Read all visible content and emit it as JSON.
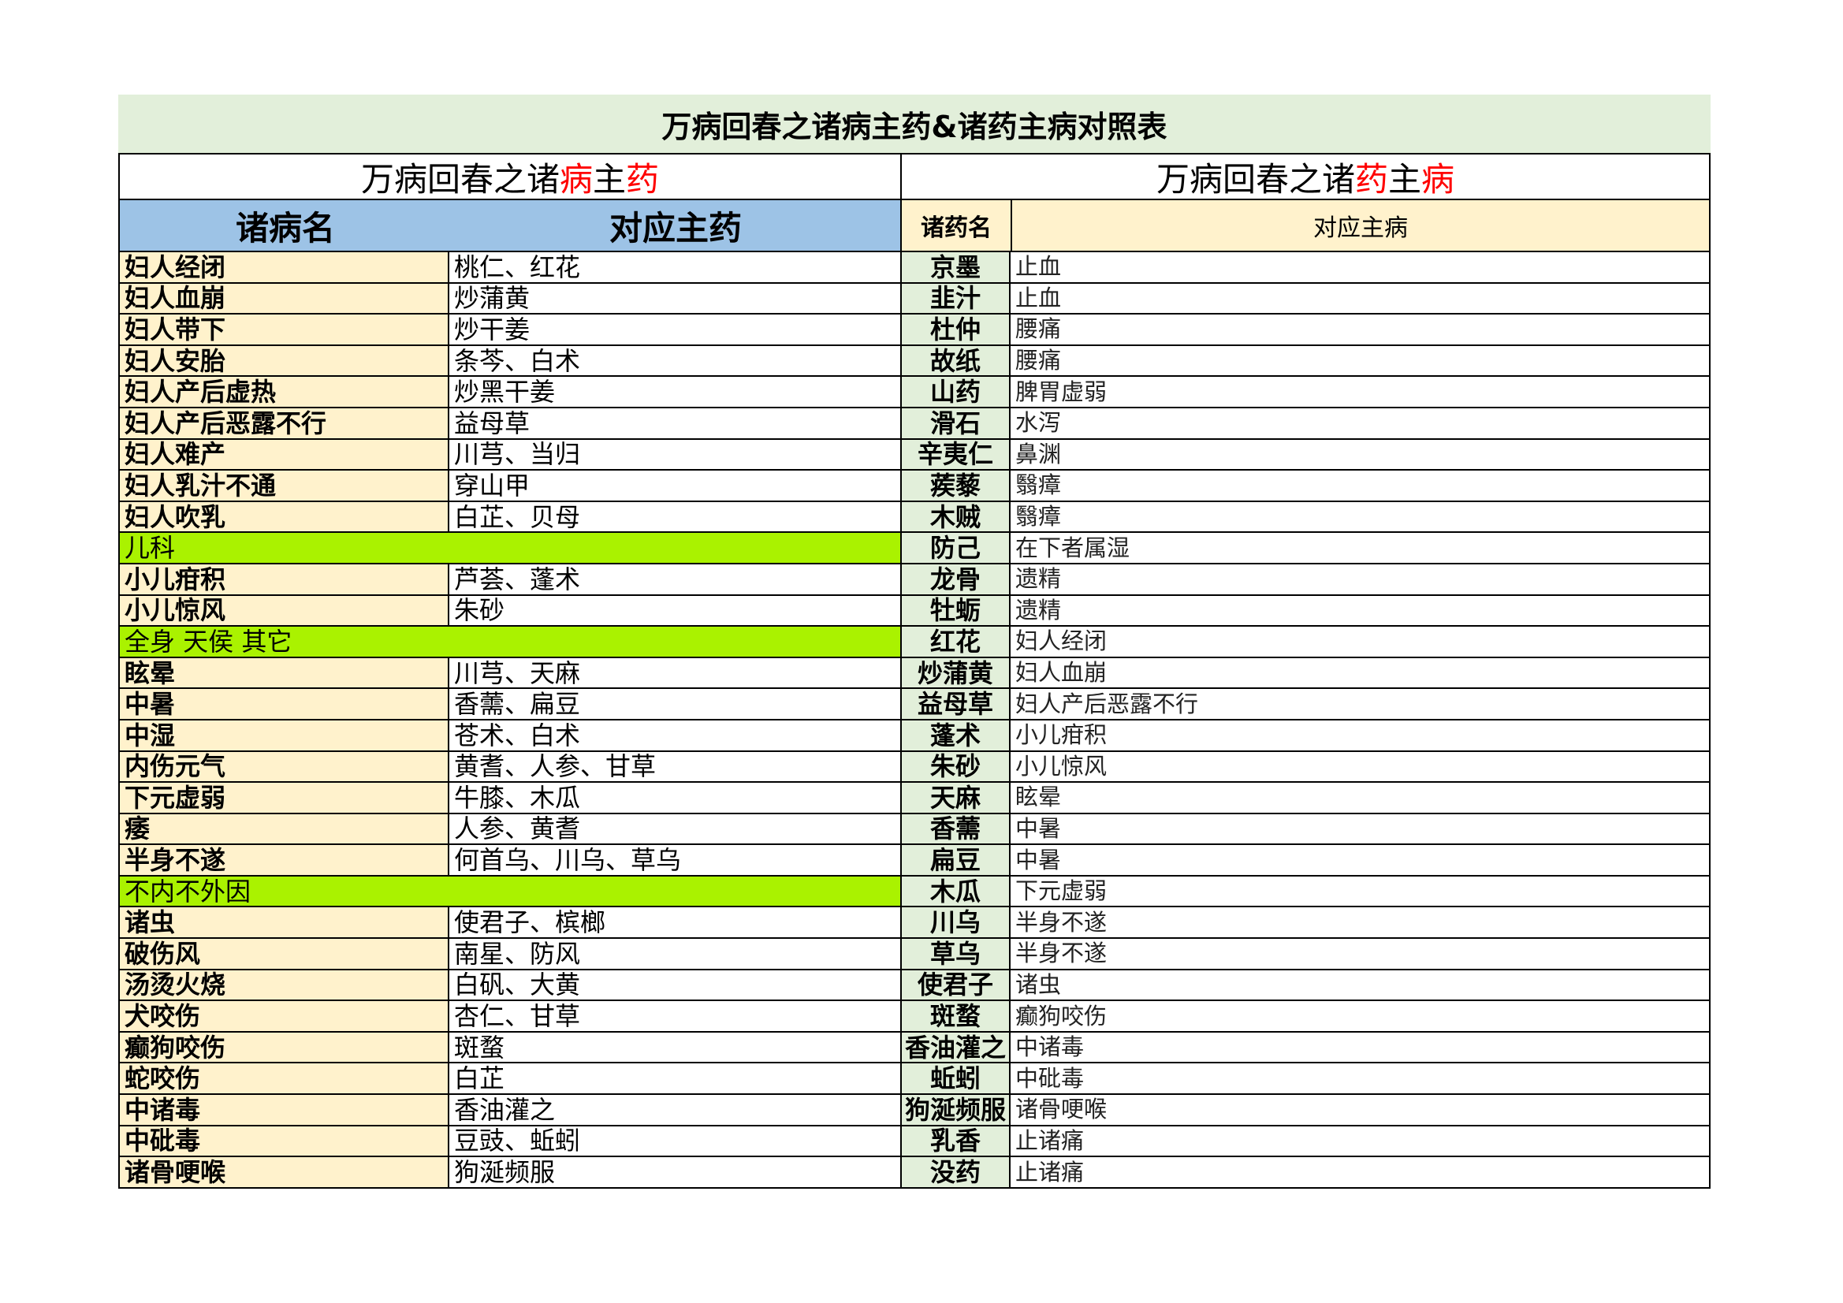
{
  "title": "万病回春之诸病主药&诸药主病对照表",
  "left_heading": {
    "pre": "万病回春之诸",
    "mid": "病",
    "mid2": "主",
    "post": "药"
  },
  "right_heading": {
    "pre": "万病回春之诸",
    "mid": "药",
    "mid2": "主",
    "post": "病"
  },
  "left_columns": {
    "name": "诸病名",
    "medicine": "对应主药"
  },
  "right_columns": {
    "name": "诸药名",
    "disease": "对应主病"
  },
  "left_rows": [
    {
      "name": "妇人经闭",
      "medicine": "桃仁、红花"
    },
    {
      "name": "妇人血崩",
      "medicine": "炒蒲黄"
    },
    {
      "name": "妇人带下",
      "medicine": "炒干姜"
    },
    {
      "name": "妇人安胎",
      "medicine": "条芩、白术"
    },
    {
      "name": "妇人产后虚热",
      "medicine": "炒黑干姜"
    },
    {
      "name": "妇人产后恶露不行",
      "medicine": "益母草"
    },
    {
      "name": "妇人难产",
      "medicine": "川芎、当归"
    },
    {
      "name": "妇人乳汁不通",
      "medicine": "穿山甲"
    },
    {
      "name": "妇人吹乳",
      "medicine": "白芷、贝母"
    },
    {
      "category": "儿科"
    },
    {
      "name": "小儿疳积",
      "medicine": "芦荟、蓬术"
    },
    {
      "name": "小儿惊风",
      "medicine": "朱砂"
    },
    {
      "category": "全身  天侯  其它"
    },
    {
      "name": "眩晕",
      "medicine": "川芎、天麻"
    },
    {
      "name": "中暑",
      "medicine": "香薷、扁豆"
    },
    {
      "name": "中湿",
      "medicine": "苍术、白术"
    },
    {
      "name": "内伤元气",
      "medicine": "黄耆、人参、甘草"
    },
    {
      "name": "下元虚弱",
      "medicine": "牛膝、木瓜"
    },
    {
      "name": "痿",
      "medicine": "人参、黄耆"
    },
    {
      "name": "半身不遂",
      "medicine": "何首乌、川乌、草乌"
    },
    {
      "category": "不内不外因"
    },
    {
      "name": "诸虫",
      "medicine": "使君子、槟榔"
    },
    {
      "name": "破伤风",
      "medicine": "南星、防风"
    },
    {
      "name": "汤烫火烧",
      "medicine": "白矾、大黄"
    },
    {
      "name": "犬咬伤",
      "medicine": "杏仁、甘草"
    },
    {
      "name": "癫狗咬伤",
      "medicine": "斑蝥"
    },
    {
      "name": "蛇咬伤",
      "medicine": "白芷"
    },
    {
      "name": "中诸毒",
      "medicine": "香油灌之"
    },
    {
      "name": "中砒毒",
      "medicine": "豆豉、蚯蚓"
    },
    {
      "name": "诸骨哽喉",
      "medicine": "狗涎频服"
    }
  ],
  "right_rows": [
    {
      "name": "京墨",
      "disease": "止血"
    },
    {
      "name": "韭汁",
      "disease": "止血"
    },
    {
      "name": "杜仲",
      "disease": "腰痛"
    },
    {
      "name": "故纸",
      "disease": "腰痛"
    },
    {
      "name": "山药",
      "disease": "脾胃虚弱"
    },
    {
      "name": "滑石",
      "disease": "水泻"
    },
    {
      "name": "辛夷仁",
      "disease": "鼻渊"
    },
    {
      "name": "蒺藜",
      "disease": "翳瘴"
    },
    {
      "name": "木贼",
      "disease": "翳瘴"
    },
    {
      "name": "防己",
      "disease": "在下者属湿"
    },
    {
      "name": "龙骨",
      "disease": "遗精"
    },
    {
      "name": "牡蛎",
      "disease": "遗精"
    },
    {
      "name": "红花",
      "disease": "妇人经闭"
    },
    {
      "name": "炒蒲黄",
      "disease": "妇人血崩"
    },
    {
      "name": "益母草",
      "disease": "妇人产后恶露不行"
    },
    {
      "name": "蓬术",
      "disease": "小儿疳积"
    },
    {
      "name": "朱砂",
      "disease": "小儿惊风"
    },
    {
      "name": "天麻",
      "disease": "眩晕"
    },
    {
      "name": "香薷",
      "disease": "中暑"
    },
    {
      "name": "扁豆",
      "disease": "中暑"
    },
    {
      "name": "木瓜",
      "disease": "下元虚弱"
    },
    {
      "name": "川乌",
      "disease": "半身不遂"
    },
    {
      "name": "草乌",
      "disease": "半身不遂"
    },
    {
      "name": "使君子",
      "disease": "诸虫"
    },
    {
      "name": "斑蝥",
      "disease": "癫狗咬伤"
    },
    {
      "name": "香油灌之",
      "disease": "中诸毒"
    },
    {
      "name": "蚯蚓",
      "disease": "中砒毒"
    },
    {
      "name": "狗涎频服",
      "disease": "诸骨哽喉"
    },
    {
      "name": "乳香",
      "disease": "止诸痛"
    },
    {
      "name": "没药",
      "disease": "止诸痛"
    }
  ]
}
